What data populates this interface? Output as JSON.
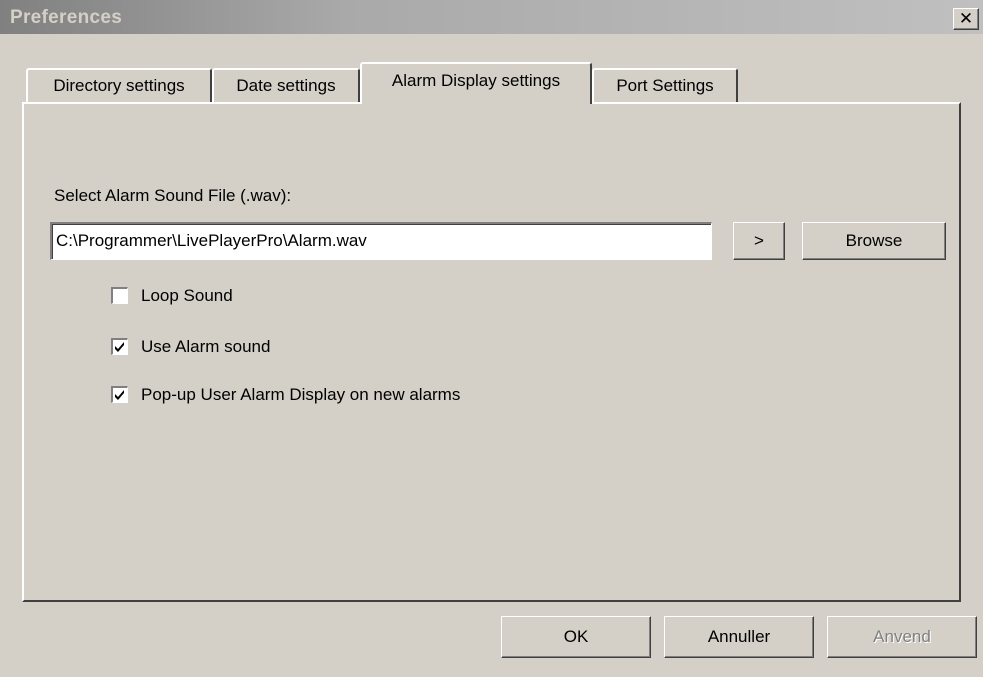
{
  "window": {
    "title": "Preferences",
    "close_glyph": "✕"
  },
  "tabs": [
    {
      "label": "Directory settings",
      "active": false
    },
    {
      "label": "Date settings",
      "active": false
    },
    {
      "label": "Alarm Display settings",
      "active": true
    },
    {
      "label": "Port Settings",
      "active": false
    }
  ],
  "alarm": {
    "file_label": "Select Alarm Sound File (.wav):",
    "file_value": "C:\\Programmer\\LivePlayerPro\\Alarm.wav",
    "arrow_label": ">",
    "browse_label": "Browse",
    "options": [
      {
        "label": "Loop Sound",
        "checked": false
      },
      {
        "label": "Use Alarm sound",
        "checked": true
      },
      {
        "label": "Pop-up User Alarm Display on new alarms",
        "checked": true
      }
    ]
  },
  "footer": {
    "ok_label": "OK",
    "cancel_label": "Annuller",
    "apply_label": "Anvend",
    "apply_disabled": true
  },
  "colors": {
    "face": "#d4d0c8",
    "title_gradient_start": "#808080",
    "title_text": "#d4d0c8"
  },
  "icons": [
    "close-icon",
    "checkmark-icon"
  ]
}
